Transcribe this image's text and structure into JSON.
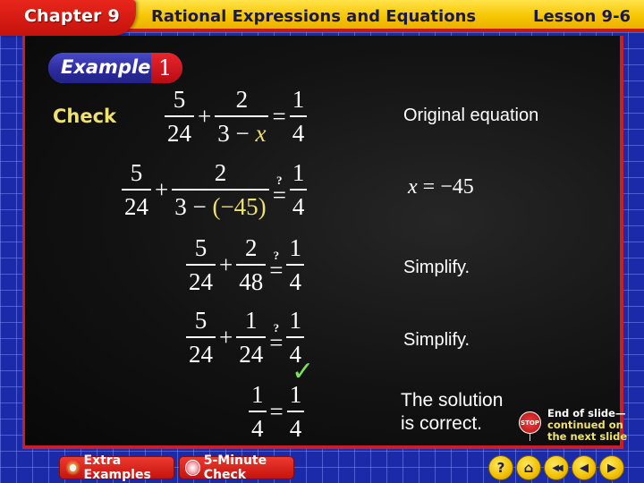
{
  "header": {
    "chapter": "Chapter 9",
    "title": "Rational Expressions and Equations",
    "lesson": "Lesson 9-6"
  },
  "colors": {
    "header_yellow": "#f6c400",
    "chapter_red": "#d81a12",
    "slide_bg": "#111111",
    "frame_blue": "#1a2aa8",
    "highlight_yellow": "#f0e070",
    "check_green": "#7ee05a"
  },
  "slide": {
    "example_label": "Example",
    "example_number": "1",
    "check_label": "Check",
    "steps": [
      {
        "terms": [
          {
            "num": "5",
            "den": "24"
          },
          {
            "num": "2",
            "den_parts": [
              "3 − ",
              "x"
            ]
          },
          {
            "num": "1",
            "den": "4"
          }
        ],
        "op1": "+",
        "relation": "=",
        "note": "Original equation"
      },
      {
        "terms": [
          {
            "num": "5",
            "den": "24"
          },
          {
            "num": "2",
            "den_parts": [
              "3 − ",
              "(−45)"
            ]
          },
          {
            "num": "1",
            "den": "4"
          }
        ],
        "op1": "+",
        "relation_mark": "?",
        "relation": "=",
        "note_parts": [
          "x",
          " = −45"
        ]
      },
      {
        "terms": [
          {
            "num": "5",
            "den": "24"
          },
          {
            "num": "2",
            "den": "48"
          },
          {
            "num": "1",
            "den": "4"
          }
        ],
        "op1": "+",
        "relation_mark": "?",
        "relation": "=",
        "note": "Simplify."
      },
      {
        "terms": [
          {
            "num": "5",
            "den": "24"
          },
          {
            "num": "1",
            "den": "24"
          },
          {
            "num": "1",
            "den": "4"
          }
        ],
        "op1": "+",
        "relation_mark": "?",
        "relation": "=",
        "note": "Simplify."
      },
      {
        "terms": [
          {
            "num": "1",
            "den": "4"
          },
          {
            "num": "1",
            "den": "4"
          }
        ],
        "relation": "=",
        "check": "✓",
        "note_lines": [
          "The solution",
          "is correct."
        ]
      }
    ],
    "end_notice": {
      "stop_icon_text": "STOP",
      "line1": "End of slide—",
      "line2": "continued on",
      "line3": "the next slide"
    }
  },
  "footer": {
    "buttons": [
      {
        "label": "Extra Examples",
        "icon": "extra-examples-icon"
      },
      {
        "label": "5-Minute Check",
        "icon": "clock-icon"
      }
    ],
    "nav": [
      {
        "name": "help",
        "glyph": "?"
      },
      {
        "name": "home",
        "glyph": "⌂"
      },
      {
        "name": "first",
        "glyph": "◀◀"
      },
      {
        "name": "previous",
        "glyph": "◀"
      },
      {
        "name": "next",
        "glyph": "▶"
      }
    ]
  }
}
